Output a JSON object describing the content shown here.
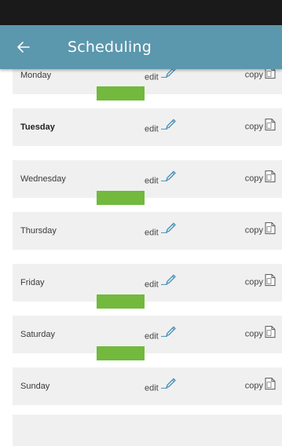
{
  "header": {
    "title": "Scheduling",
    "back_icon": "arrow-left-icon"
  },
  "colors": {
    "app_bar": "#5b97ad",
    "status_bar": "#1a1a1a",
    "row_background": "#f0f0f0",
    "active_indicator": "#72b93e",
    "pencil_icon": "#4a90b8"
  },
  "days": [
    {
      "label": "Monday",
      "edit_label": "edit",
      "copy_label": "copy",
      "has_schedule": true
    },
    {
      "label": "Tuesday",
      "edit_label": "edit",
      "copy_label": "copy",
      "has_schedule": false
    },
    {
      "label": "Wednesday",
      "edit_label": "edit",
      "copy_label": "copy",
      "has_schedule": true
    },
    {
      "label": "Thursday",
      "edit_label": "edit",
      "copy_label": "copy",
      "has_schedule": false
    },
    {
      "label": "Friday",
      "edit_label": "edit",
      "copy_label": "copy",
      "has_schedule": true
    },
    {
      "label": "Saturday",
      "edit_label": "edit",
      "copy_label": "copy",
      "has_schedule": true
    },
    {
      "label": "Sunday",
      "edit_label": "edit",
      "copy_label": "copy",
      "has_schedule": false
    }
  ]
}
